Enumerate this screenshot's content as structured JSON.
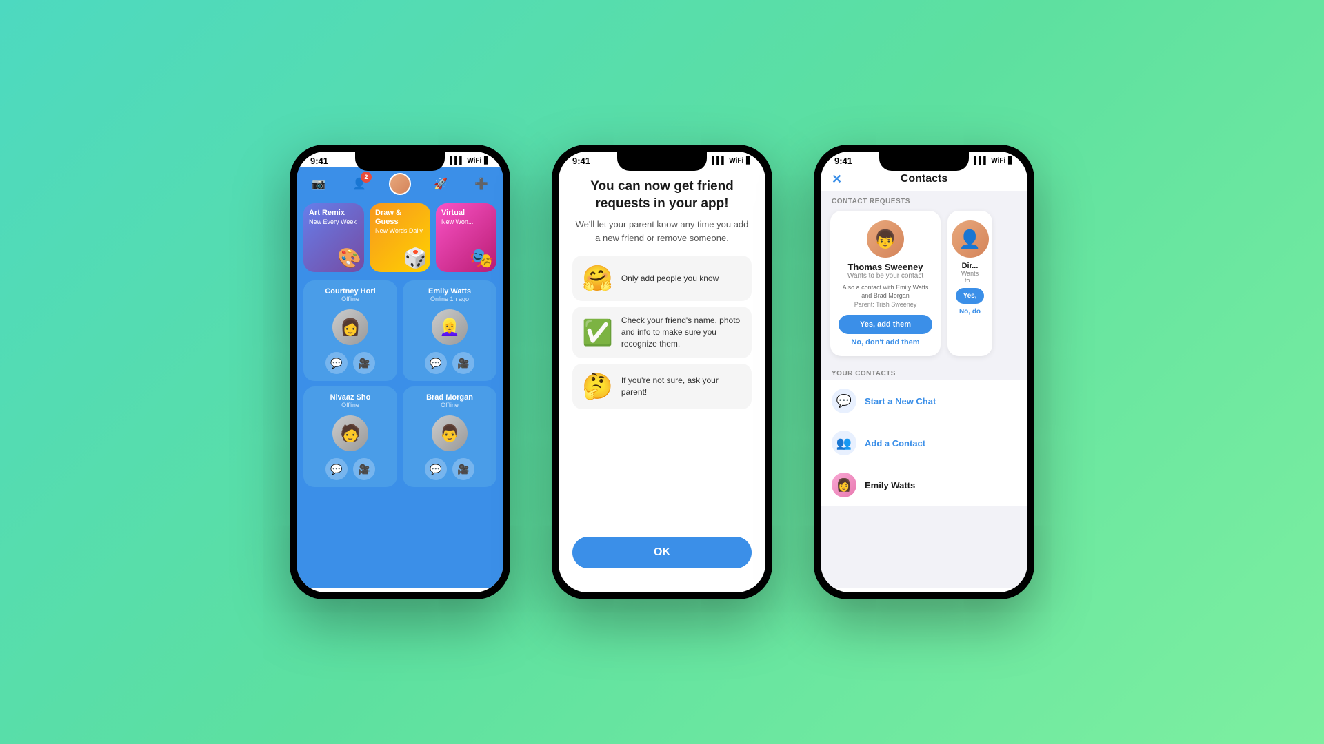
{
  "background": {
    "gradient": "linear-gradient(135deg, #4dd9c0 0%, #5de0a0 50%, #7defa0 100%)"
  },
  "phone1": {
    "statusBar": {
      "time": "9:41",
      "signal": "▌▌▌",
      "wifi": "WiFi",
      "battery": "🔋"
    },
    "topbar": {
      "cameraIcon": "📷",
      "friendIcon": "👤",
      "badgeCount": "2",
      "rocketIcon": "🚀",
      "addIcon": "➕"
    },
    "games": [
      {
        "title": "Art Remix",
        "subtitle": "New Every Week",
        "emoji": "🎨",
        "color": "purple"
      },
      {
        "title": "Draw & Guess",
        "subtitle": "New Words Daily",
        "emoji": "🎲",
        "color": "orange"
      },
      {
        "title": "Virtual",
        "subtitle": "New Won...",
        "emoji": "🎭",
        "color": "pink"
      }
    ],
    "contacts": [
      {
        "name": "Courtney Hori",
        "status": "Offline",
        "emoji": "👩"
      },
      {
        "name": "Emily Watts",
        "status": "Online 1h ago",
        "emoji": "👱‍♀️"
      },
      {
        "name": "Nivaaz Sho",
        "status": "Offline",
        "emoji": "🧑"
      },
      {
        "name": "Brad Morgan",
        "status": "Offline",
        "emoji": "👨"
      }
    ]
  },
  "phone2": {
    "statusBar": {
      "time": "9:41"
    },
    "title": "You can now get friend requests in your app!",
    "subtitle": "We'll let your parent know any time you add a new friend or remove someone.",
    "tips": [
      {
        "emoji": "🤗",
        "text": "Only add people you know"
      },
      {
        "emoji": "✅",
        "text": "Check your friend's name, photo and info to make sure you recognize them."
      },
      {
        "emoji": "🤔",
        "text": "If you're not sure, ask your parent!"
      }
    ],
    "okButton": "OK"
  },
  "phone3": {
    "statusBar": {
      "time": "9:41"
    },
    "header": {
      "title": "Contacts",
      "closeIcon": "✕"
    },
    "contactRequestsLabel": "CONTACT REQUESTS",
    "yourContactsLabel": "YOUR CONTACTS",
    "requests": [
      {
        "name": "Thomas Sweeney",
        "wantsText": "Wants to be your contact",
        "alsoText": "Also a contact with Emily Watts and Brad Morgan",
        "parentText": "Parent: Trish Sweeney",
        "addBtn": "Yes, add them",
        "noBtn": "No, don't add them",
        "emoji": "👦"
      },
      {
        "name": "Dir...",
        "wantsText": "Wants to...",
        "addBtn": "Yes,",
        "noBtn": "No, do",
        "emoji": "👤"
      }
    ],
    "yourContacts": [
      {
        "icon": "💬",
        "text": "Start a New Chat",
        "type": "action"
      },
      {
        "icon": "👥",
        "text": "Add a Contact",
        "type": "action"
      },
      {
        "icon": "👩",
        "text": "Emily Watts",
        "type": "contact"
      }
    ]
  }
}
